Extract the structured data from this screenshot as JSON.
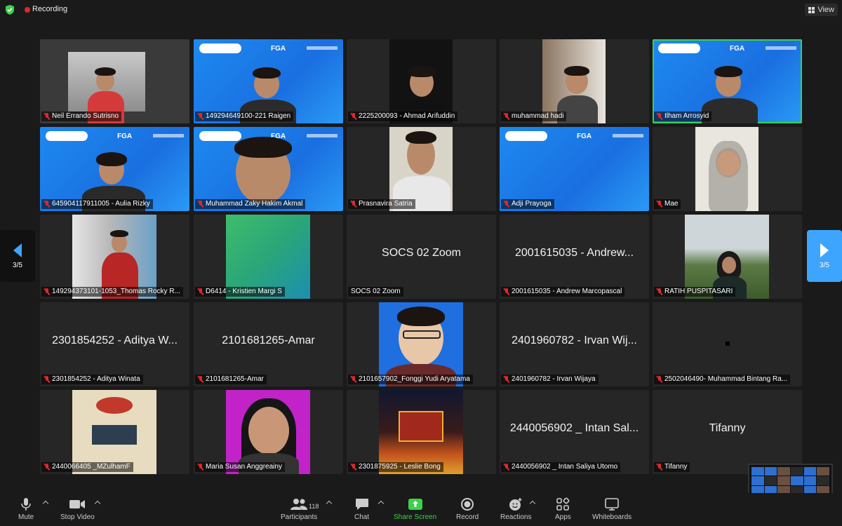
{
  "topbar": {
    "recording_label": "Recording",
    "view_label": "View"
  },
  "pager": {
    "left_page": "3/5",
    "right_page": "3/5"
  },
  "tiles": [
    {
      "label": "Neil Errando Sutrisno",
      "big": ""
    },
    {
      "label": "149294649100-221 Raigen",
      "big": ""
    },
    {
      "label": "2225200093 - Ahmad Arifuddin",
      "big": ""
    },
    {
      "label": "muhammad hadi",
      "big": ""
    },
    {
      "label": "Ilham Arrosyid",
      "big": ""
    },
    {
      "label": "645904117911005 - Aulia Rizky",
      "big": ""
    },
    {
      "label": "Muhammad Zaky Hakim Akmal",
      "big": ""
    },
    {
      "label": "Prasnavira Satria",
      "big": ""
    },
    {
      "label": "Adji Prayoga",
      "big": ""
    },
    {
      "label": "Mae",
      "big": ""
    },
    {
      "label": "149294373101-1053_Thomas Rocky R...",
      "big": ""
    },
    {
      "label": "D6414 - Kristien Margi S",
      "big": ""
    },
    {
      "label": "SOCS 02 Zoom",
      "big": "SOCS 02 Zoom"
    },
    {
      "label": "2001615035 - Andrew Marcopascal",
      "big": "2001615035 - Andrew..."
    },
    {
      "label": "RATIH PUSPITASARI",
      "big": ""
    },
    {
      "label": "2301854252 - Aditya Winata",
      "big": "2301854252 - Aditya W..."
    },
    {
      "label": "2101681265-Amar",
      "big": "2101681265-Amar"
    },
    {
      "label": "2101657902_Fonggi Yudi Aryatama",
      "big": ""
    },
    {
      "label": "2401960782 - Irvan Wijaya",
      "big": "2401960782 - Irvan Wij..."
    },
    {
      "label": "2502046490- Muhammad Bintang Ra...",
      "big": ""
    },
    {
      "label": "2440066405 _MZulhamF",
      "big": ""
    },
    {
      "label": "Maria Susan Anggreainy",
      "big": ""
    },
    {
      "label": "2301875925 - Leslie Bong",
      "big": ""
    },
    {
      "label": "2440056902 _ Intan Saliya Utomo",
      "big": "2440056902 _ Intan Sal..."
    },
    {
      "label": "Tifanny",
      "big": "Tifanny"
    }
  ],
  "fga": {
    "brand": "FGA"
  },
  "toolbar": {
    "mute": "Mute",
    "stop_video": "Stop Video",
    "participants": "Participants",
    "participants_count": "118",
    "chat": "Chat",
    "share_screen": "Share Screen",
    "record": "Record",
    "reactions": "Reactions",
    "apps": "Apps",
    "whiteboards": "Whiteboards"
  },
  "colors": {
    "active_speaker": "#3ed04a",
    "recording": "#e02828",
    "share": "#3ed04a",
    "pager": "#3ea5ff"
  }
}
